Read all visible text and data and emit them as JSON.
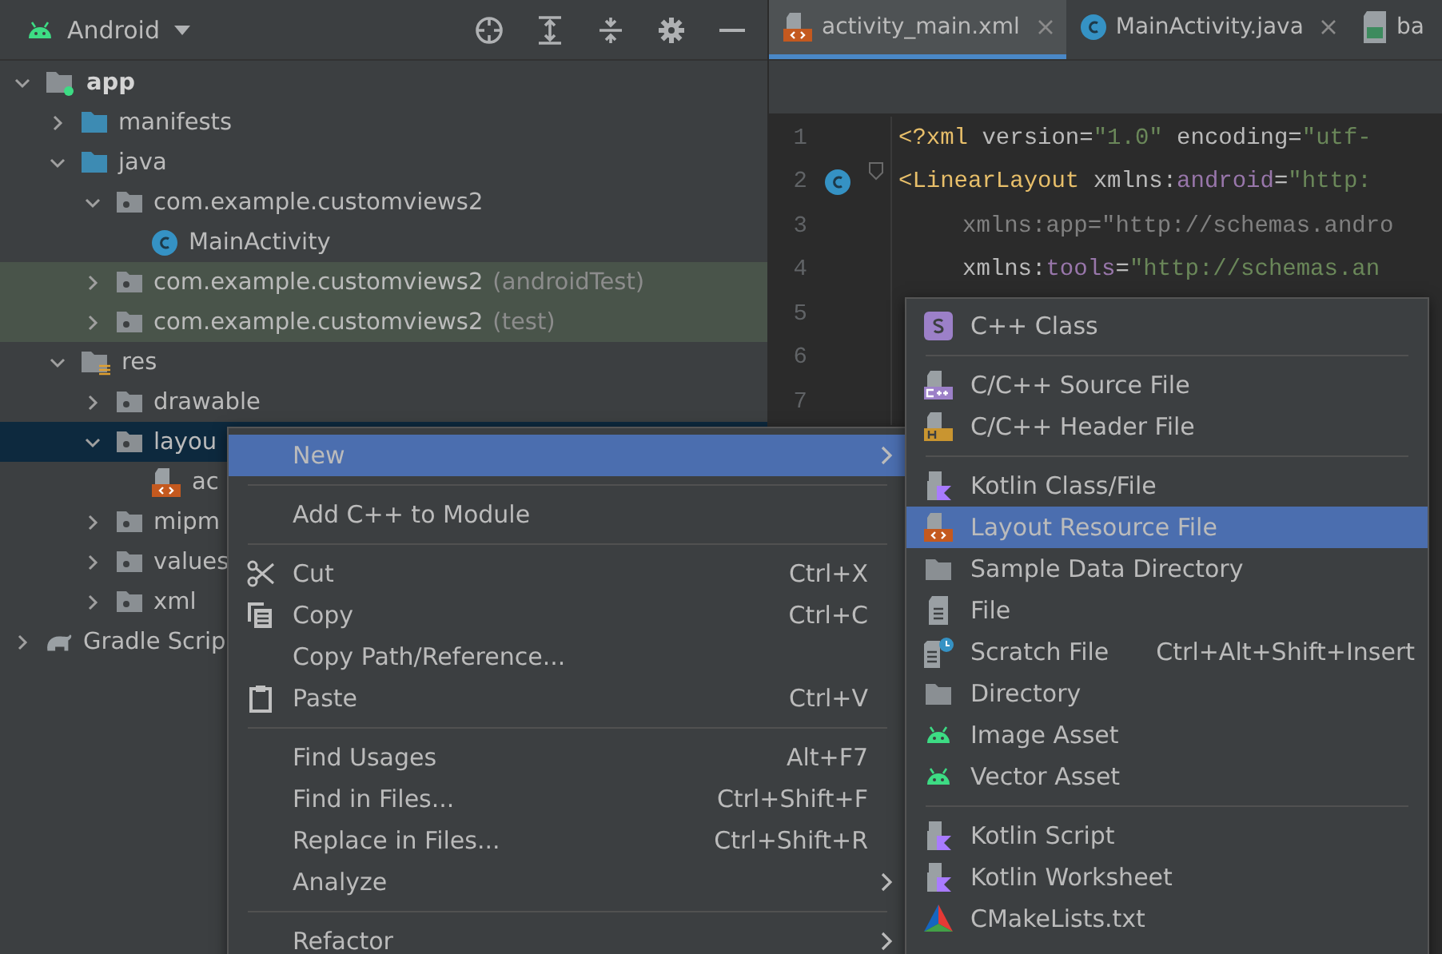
{
  "project_panel": {
    "view": "Android",
    "tree": [
      {
        "label": "app",
        "kind": "module",
        "expanded": true,
        "selected": false,
        "children": [
          {
            "label": "manifests",
            "kind": "folder",
            "expanded": false,
            "selected": false
          },
          {
            "label": "java",
            "kind": "folder",
            "expanded": true,
            "selected": false,
            "children": [
              {
                "label": "com.example.customviews2",
                "kind": "package",
                "expanded": true,
                "selected": false,
                "children": [
                  {
                    "label": "MainActivity",
                    "kind": "class",
                    "selected": false
                  }
                ]
              },
              {
                "label": "com.example.customviews2",
                "suffix": "(androidTest)",
                "kind": "package",
                "test": true,
                "expanded": false,
                "selected": false
              },
              {
                "label": "com.example.customviews2",
                "suffix": "(test)",
                "kind": "package",
                "test": true,
                "expanded": false,
                "selected": false
              }
            ]
          },
          {
            "label": "res",
            "kind": "res",
            "expanded": true,
            "selected": false,
            "children": [
              {
                "label": "drawable",
                "kind": "package",
                "expanded": false,
                "selected": false
              },
              {
                "label": "layou",
                "kind": "package",
                "expanded": true,
                "selected": true,
                "children": [
                  {
                    "label": "ac",
                    "kind": "layout",
                    "selected": false
                  }
                ]
              },
              {
                "label": "mipm",
                "kind": "package",
                "expanded": false,
                "selected": false
              },
              {
                "label": "values",
                "kind": "package",
                "expanded": false,
                "selected": false
              },
              {
                "label": "xml",
                "kind": "package",
                "expanded": false,
                "selected": false
              }
            ]
          }
        ]
      },
      {
        "label": "Gradle Scrip",
        "kind": "gradle",
        "expanded": false,
        "selected": false
      }
    ]
  },
  "editor": {
    "tabs": [
      {
        "label": "activity_main.xml",
        "kind": "layout",
        "selected": true,
        "closable": true
      },
      {
        "label": "MainActivity.java",
        "kind": "class",
        "selected": false,
        "closable": true
      },
      {
        "label": "ba",
        "kind": "image",
        "selected": false,
        "closable": false
      }
    ],
    "lines": [
      {
        "number": "1",
        "gutter": false,
        "fold": false,
        "indent": false,
        "tokens": [
          {
            "text": "<?xml",
            "kind": "tag"
          },
          {
            "text": " version=",
            "kind": "attr"
          },
          {
            "text": "\"1.0\"",
            "kind": "str"
          },
          {
            "text": " encoding=",
            "kind": "attr"
          },
          {
            "text": "\"utf-",
            "kind": "str"
          }
        ]
      },
      {
        "number": "2",
        "gutter": true,
        "fold": true,
        "indent": false,
        "tokens": [
          {
            "text": "<LinearLayout",
            "kind": "tag"
          },
          {
            "text": " xmlns:",
            "kind": "attr"
          },
          {
            "text": "android",
            "kind": "ns"
          },
          {
            "text": "=",
            "kind": "attr"
          },
          {
            "text": "\"http:",
            "kind": "str"
          }
        ]
      },
      {
        "number": "3",
        "gutter": false,
        "fold": false,
        "indent": true,
        "tokens": [
          {
            "text": "xmlns:app=\"http://schemas.andro",
            "kind": "dim"
          }
        ]
      },
      {
        "number": "4",
        "gutter": false,
        "fold": false,
        "indent": true,
        "tokens": [
          {
            "text": "xmlns:",
            "kind": "attr"
          },
          {
            "text": "tools",
            "kind": "ns"
          },
          {
            "text": "=",
            "kind": "attr"
          },
          {
            "text": "\"http://schemas.an",
            "kind": "str"
          }
        ]
      },
      {
        "number": "5"
      },
      {
        "number": "6"
      },
      {
        "number": "7"
      }
    ]
  },
  "context_menu": [
    {
      "kind": "plain",
      "label": "New",
      "submenu": true,
      "selected": true
    },
    {
      "kind": "separator"
    },
    {
      "kind": "plain",
      "label": "Add C++ to Module",
      "submenu": false,
      "selected": false
    },
    {
      "kind": "separator"
    },
    {
      "kind": "cut",
      "label": "Cut",
      "shortcut": "Ctrl+X",
      "submenu": false,
      "selected": false
    },
    {
      "kind": "copy",
      "label": "Copy",
      "shortcut": "Ctrl+C",
      "submenu": false,
      "selected": false
    },
    {
      "kind": "plain",
      "label": "Copy Path/Reference...",
      "submenu": false,
      "selected": false
    },
    {
      "kind": "paste",
      "label": "Paste",
      "shortcut": "Ctrl+V",
      "submenu": false,
      "selected": false
    },
    {
      "kind": "separator"
    },
    {
      "kind": "plain",
      "label": "Find Usages",
      "shortcut": "Alt+F7",
      "submenu": false,
      "selected": false
    },
    {
      "kind": "plain",
      "label": "Find in Files...",
      "shortcut": "Ctrl+Shift+F",
      "submenu": false,
      "selected": false
    },
    {
      "kind": "plain",
      "label": "Replace in Files...",
      "shortcut": "Ctrl+Shift+R",
      "submenu": false,
      "selected": false
    },
    {
      "kind": "plain",
      "label": "Analyze",
      "submenu": true,
      "selected": false
    },
    {
      "kind": "separator"
    },
    {
      "kind": "plain",
      "label": "Refactor",
      "submenu": true,
      "selected": false
    }
  ],
  "submenu": [
    {
      "kind": "cppclass",
      "label": "C++ Class",
      "selected": false
    },
    {
      "kind": "separator"
    },
    {
      "kind": "cppsource",
      "label": "C/C++ Source File",
      "selected": false
    },
    {
      "kind": "cppheader",
      "label": "C/C++ Header File",
      "selected": false
    },
    {
      "kind": "separator"
    },
    {
      "kind": "kotlin",
      "label": "Kotlin Class/File",
      "selected": false
    },
    {
      "kind": "layout",
      "label": "Layout Resource File",
      "selected": true
    },
    {
      "kind": "folder",
      "label": "Sample Data Directory",
      "selected": false
    },
    {
      "kind": "file",
      "label": "File",
      "selected": false
    },
    {
      "kind": "scratch",
      "label": "Scratch File",
      "shortcut": "Ctrl+Alt+Shift+Insert",
      "selected": false
    },
    {
      "kind": "folder",
      "label": "Directory",
      "selected": false
    },
    {
      "kind": "android",
      "label": "Image Asset",
      "selected": false
    },
    {
      "kind": "android",
      "label": "Vector Asset",
      "selected": false
    },
    {
      "kind": "separator"
    },
    {
      "kind": "kotlin",
      "label": "Kotlin Script",
      "selected": false
    },
    {
      "kind": "kotlin",
      "label": "Kotlin Worksheet",
      "selected": false
    },
    {
      "kind": "cmake",
      "label": "CMakeLists.txt",
      "selected": false
    }
  ]
}
